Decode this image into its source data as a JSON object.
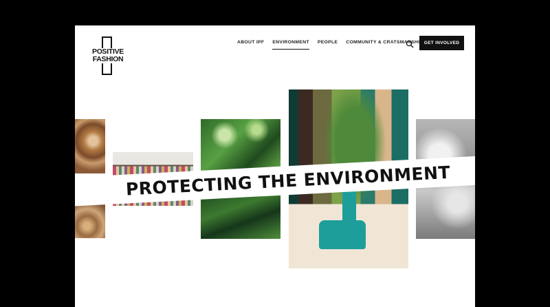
{
  "brand": {
    "line1": "POSITIVE",
    "line2": "FASHION"
  },
  "nav": {
    "items": [
      {
        "label": "ABOUT IPF",
        "active": false
      },
      {
        "label": "ENVIRONMENT",
        "active": true
      },
      {
        "label": "PEOPLE",
        "active": false
      },
      {
        "label": "COMMUNITY & CRATSMANSHIP",
        "active": false
      }
    ],
    "search_icon": "search-icon",
    "cta_label": "GET INVOLVED"
  },
  "hero": {
    "title": "PROTECTING THE ENVIRONMENT"
  },
  "colors": {
    "ink": "#111111",
    "page": "#ffffff",
    "frame": "#000000",
    "accent_teal": "#1e9e9a"
  }
}
